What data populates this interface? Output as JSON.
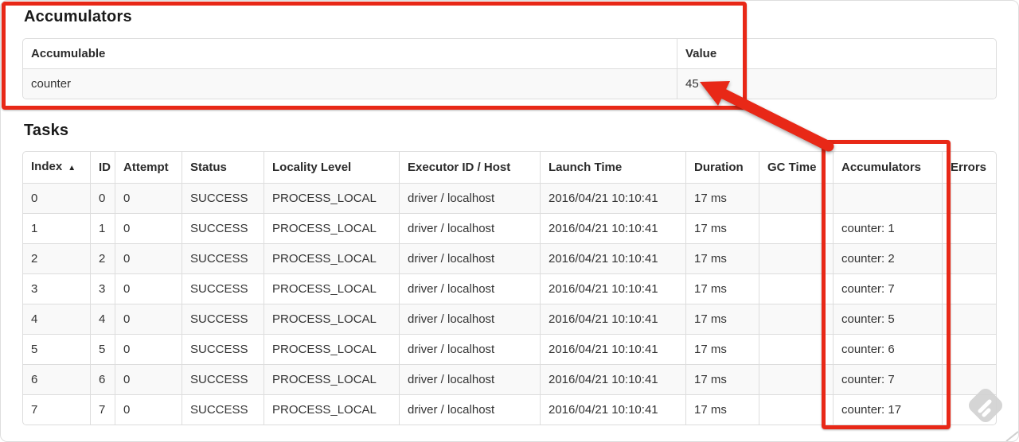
{
  "colors": {
    "annotation_red": "#e82817",
    "table_border": "#dddddd",
    "row_stripe": "#f9f9f9",
    "text": "#333333",
    "heading": "#1a1a1a",
    "watermark_gray": "#d2d2d2"
  },
  "accumulators_section": {
    "title": "Accumulators",
    "columns": [
      "Accumulable",
      "Value"
    ],
    "rows": [
      {
        "accumulable": "counter",
        "value": "45"
      }
    ]
  },
  "tasks_section": {
    "title": "Tasks",
    "sort_indicator": "▲",
    "columns": [
      "Index",
      "ID",
      "Attempt",
      "Status",
      "Locality Level",
      "Executor ID / Host",
      "Launch Time",
      "Duration",
      "GC Time",
      "Accumulators",
      "Errors"
    ],
    "rows": [
      {
        "index": "0",
        "id": "0",
        "attempt": "0",
        "status": "SUCCESS",
        "locality": "PROCESS_LOCAL",
        "executor": "driver / localhost",
        "launch": "2016/04/21 10:10:41",
        "duration": "17 ms",
        "gc": "",
        "accumulators": "",
        "errors": ""
      },
      {
        "index": "1",
        "id": "1",
        "attempt": "0",
        "status": "SUCCESS",
        "locality": "PROCESS_LOCAL",
        "executor": "driver / localhost",
        "launch": "2016/04/21 10:10:41",
        "duration": "17 ms",
        "gc": "",
        "accumulators": "counter: 1",
        "errors": ""
      },
      {
        "index": "2",
        "id": "2",
        "attempt": "0",
        "status": "SUCCESS",
        "locality": "PROCESS_LOCAL",
        "executor": "driver / localhost",
        "launch": "2016/04/21 10:10:41",
        "duration": "17 ms",
        "gc": "",
        "accumulators": "counter: 2",
        "errors": ""
      },
      {
        "index": "3",
        "id": "3",
        "attempt": "0",
        "status": "SUCCESS",
        "locality": "PROCESS_LOCAL",
        "executor": "driver / localhost",
        "launch": "2016/04/21 10:10:41",
        "duration": "17 ms",
        "gc": "",
        "accumulators": "counter: 7",
        "errors": ""
      },
      {
        "index": "4",
        "id": "4",
        "attempt": "0",
        "status": "SUCCESS",
        "locality": "PROCESS_LOCAL",
        "executor": "driver / localhost",
        "launch": "2016/04/21 10:10:41",
        "duration": "17 ms",
        "gc": "",
        "accumulators": "counter: 5",
        "errors": ""
      },
      {
        "index": "5",
        "id": "5",
        "attempt": "0",
        "status": "SUCCESS",
        "locality": "PROCESS_LOCAL",
        "executor": "driver / localhost",
        "launch": "2016/04/21 10:10:41",
        "duration": "17 ms",
        "gc": "",
        "accumulators": "counter: 6",
        "errors": ""
      },
      {
        "index": "6",
        "id": "6",
        "attempt": "0",
        "status": "SUCCESS",
        "locality": "PROCESS_LOCAL",
        "executor": "driver / localhost",
        "launch": "2016/04/21 10:10:41",
        "duration": "17 ms",
        "gc": "",
        "accumulators": "counter: 7",
        "errors": ""
      },
      {
        "index": "7",
        "id": "7",
        "attempt": "0",
        "status": "SUCCESS",
        "locality": "PROCESS_LOCAL",
        "executor": "driver / localhost",
        "launch": "2016/04/21 10:10:41",
        "duration": "17 ms",
        "gc": "",
        "accumulators": "counter: 17",
        "errors": ""
      }
    ]
  },
  "annotations": {
    "highlight_boxes": [
      {
        "target": "accumulators-section"
      },
      {
        "target": "tasks-accumulators-column"
      }
    ],
    "arrow": {
      "from": "tasks-accumulators-column",
      "to": "accumulator-total-value-45"
    }
  },
  "watermark": {
    "icon": "feedly-like-badge"
  }
}
